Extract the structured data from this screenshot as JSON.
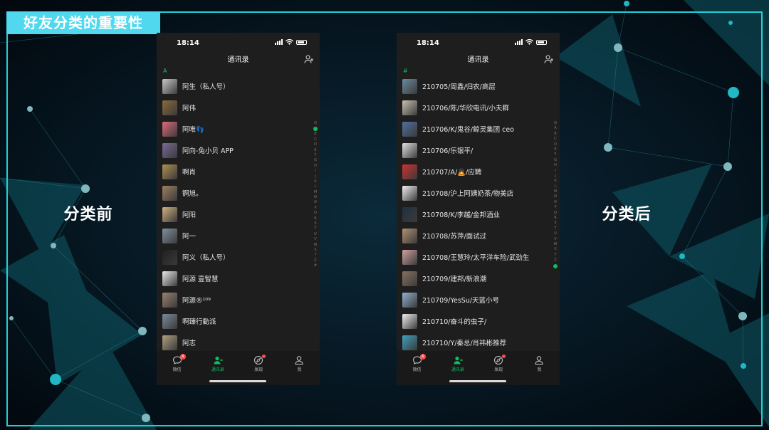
{
  "slide": {
    "title": "好友分类的重要性",
    "label_before": "分类前",
    "label_after": "分类后"
  },
  "colors": {
    "accent": "#07c160",
    "frame": "#1fd1d6",
    "badge": "#fa5151"
  },
  "index_letters": [
    "Q",
    "A",
    "B",
    "C",
    "D",
    "E",
    "F",
    "G",
    "H",
    "I",
    "J",
    "K",
    "L",
    "M",
    "N",
    "O",
    "P",
    "Q",
    "R",
    "S",
    "T",
    "U",
    "V",
    "W",
    "X",
    "Y",
    "Z",
    "#"
  ],
  "phones": [
    {
      "time": "18:14",
      "title": "通讯录",
      "section": "A",
      "index_active": 1,
      "contacts": [
        {
          "name": "阿生（私人号）",
          "color": "#c8c8c8"
        },
        {
          "name": "阿伟",
          "color": "#8a6a3a"
        },
        {
          "name": "阿唯👣",
          "color": "#e06a7a"
        },
        {
          "name": "阿向-兔小贝 APP",
          "color": "#7a6a9a"
        },
        {
          "name": "啊肖",
          "color": "#b09050"
        },
        {
          "name": "锕旭。",
          "color": "#a08060"
        },
        {
          "name": "阿阳",
          "color": "#d0b080"
        },
        {
          "name": "阿一",
          "color": "#8090a0"
        },
        {
          "name": "阿义（私人号）",
          "color": "#202020"
        },
        {
          "name": "阿源 壹智慧",
          "color": "#e8e8e8"
        },
        {
          "name": "阿源®¹⁰⁹",
          "color": "#9a8070"
        },
        {
          "name": "啊臻行動派",
          "color": "#7a8a9a"
        },
        {
          "name": "阿志",
          "color": "#b0a080"
        }
      ],
      "tabs": [
        {
          "label": "微信",
          "badge": "4"
        },
        {
          "label": "通讯录",
          "badge": ""
        },
        {
          "label": "发现",
          "badge": ""
        },
        {
          "label": "我",
          "badge": ""
        }
      ]
    },
    {
      "time": "18:14",
      "title": "通讯录",
      "section": "#",
      "index_active": 27,
      "contacts": [
        {
          "name": "210705/周鑫/归农/高层",
          "color": "#6a8aa0"
        },
        {
          "name": "210706/陈/华欣电讯/小夫群",
          "color": "#c8c0b0"
        },
        {
          "name": "210706/K/鬼谷/鲸灵集团 ceo",
          "color": "#5070a0"
        },
        {
          "name": "210706/乐银平/",
          "color": "#e0e0e0"
        },
        {
          "name": "210707/A/🙇/应聘",
          "color": "#d03030"
        },
        {
          "name": "210708/沪上阿姨奶茶/物美店",
          "color": "#f0f0f0"
        },
        {
          "name": "210708/K/李越/金邦酒业",
          "color": "#203040"
        },
        {
          "name": "210708/苏萍/面试过",
          "color": "#b09070"
        },
        {
          "name": "210708/王慧玲/太平洋车险/武劲生",
          "color": "#d0a0a0"
        },
        {
          "name": "210709/建邦/新浪潮",
          "color": "#8a7060"
        },
        {
          "name": "210709/YesSu/天蓝小号",
          "color": "#90b0d0"
        },
        {
          "name": "210710/奋斗的虫子/",
          "color": "#f0f0f0"
        },
        {
          "name": "210710/Y/秦总/肖祎彬推荐",
          "color": "#40a0c0"
        }
      ],
      "tabs": [
        {
          "label": "微信",
          "badge": "4"
        },
        {
          "label": "通讯录",
          "badge": ""
        },
        {
          "label": "发现",
          "badge": ""
        },
        {
          "label": "我",
          "badge": ""
        }
      ]
    }
  ]
}
